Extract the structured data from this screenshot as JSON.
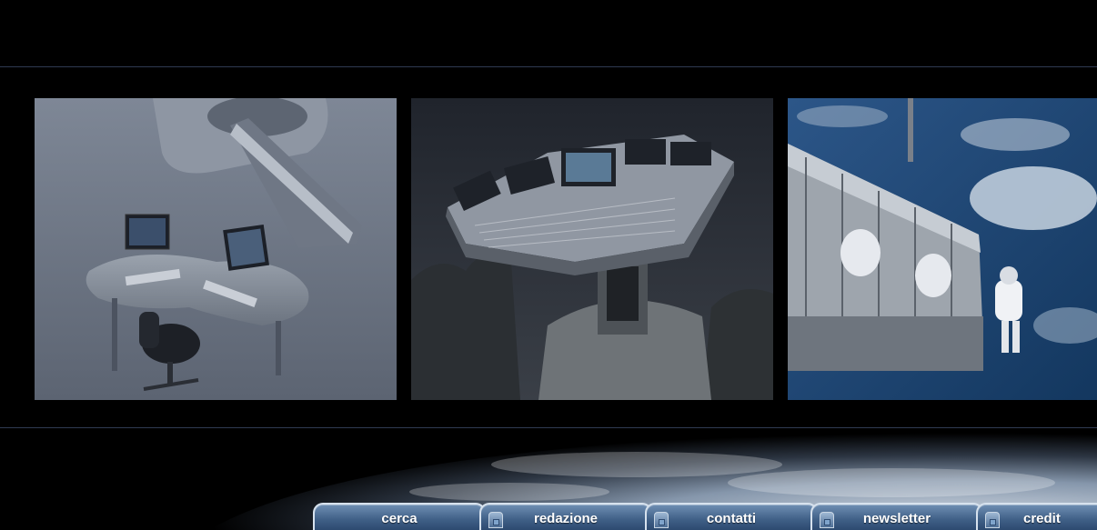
{
  "panels": [
    {
      "id": "medical",
      "icon": "medical-workstation-image"
    },
    {
      "id": "console",
      "icon": "audio-console-image"
    },
    {
      "id": "space",
      "icon": "space-station-image"
    }
  ],
  "nav": {
    "items": [
      {
        "label": "cerca"
      },
      {
        "label": "redazione"
      },
      {
        "label": "contatti"
      },
      {
        "label": "newsletter"
      },
      {
        "label": "credit"
      }
    ]
  },
  "colors": {
    "background": "#000000",
    "rule": "#2f3a52",
    "tab": "#3f5f86",
    "tab_border": "#d7e2ee"
  }
}
